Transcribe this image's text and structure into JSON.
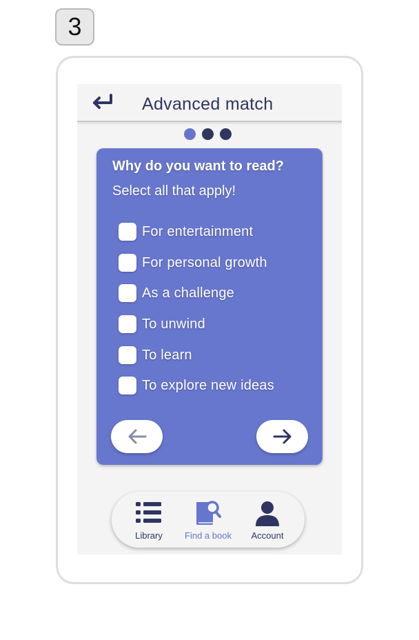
{
  "step_number": "3",
  "header": {
    "title": "Advanced match",
    "back_icon": "back-arrow-icon"
  },
  "progress": {
    "total_steps": 3,
    "current_step": 1
  },
  "question": {
    "title": "Why do you want to read?",
    "subtitle": "Select all that apply!",
    "options": [
      {
        "label": "For entertainment",
        "checked": false
      },
      {
        "label": "For personal growth",
        "checked": false
      },
      {
        "label": "As a challenge",
        "checked": false
      },
      {
        "label": "To unwind",
        "checked": false
      },
      {
        "label": "To learn",
        "checked": false
      },
      {
        "label": "To explore new ideas",
        "checked": false
      }
    ]
  },
  "navigation": {
    "prev_icon": "arrow-left-icon",
    "next_icon": "arrow-right-icon"
  },
  "bottom_nav": {
    "items": [
      {
        "label": "Library",
        "icon": "list-icon",
        "active": false
      },
      {
        "label": "Find a book",
        "icon": "book-search-icon",
        "active": true
      },
      {
        "label": "Account",
        "icon": "person-icon",
        "active": false
      }
    ]
  },
  "colors": {
    "accent": "#6877ce",
    "dark_navy": "#2e3563",
    "screen_bg": "#f4f4f4",
    "disabled_arrow": "#8a8da6"
  }
}
